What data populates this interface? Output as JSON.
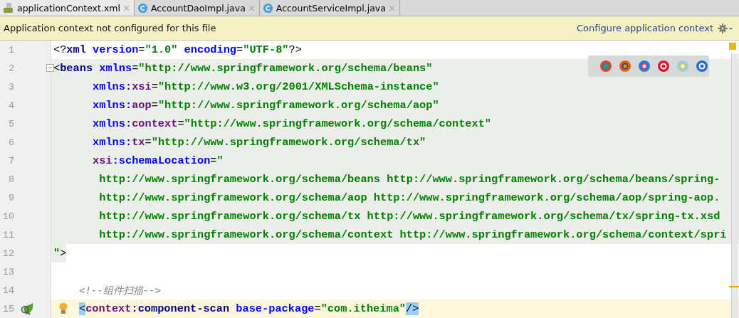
{
  "tabs": [
    {
      "label": "applicationContext.xml",
      "kind": "xml",
      "selected": true
    },
    {
      "label": "AccountDaoImpl.java",
      "kind": "class",
      "selected": false
    },
    {
      "label": "AccountServiceImpl.java",
      "kind": "class",
      "selected": false
    }
  ],
  "banner": {
    "message": "Application context not configured for this file",
    "link": "Configure application context"
  },
  "editor": {
    "lines": [
      {
        "number": "1",
        "kind": "plain",
        "nested": false,
        "fold": false,
        "current": false,
        "tokens": [
          {
            "kind": "punct",
            "text": "<?"
          },
          {
            "kind": "tag",
            "text": "xml"
          },
          {
            "kind": "attr",
            "text": " version"
          },
          {
            "kind": "punct",
            "text": "="
          },
          {
            "kind": "value",
            "text": "\"1.0\""
          },
          {
            "kind": "attr",
            "text": " encoding"
          },
          {
            "kind": "punct",
            "text": "="
          },
          {
            "kind": "value",
            "text": "\"UTF-8\""
          },
          {
            "kind": "punct",
            "text": "?>"
          }
        ]
      },
      {
        "number": "2",
        "kind": "scope",
        "nested": false,
        "fold": true,
        "current": false,
        "tokens": [
          {
            "kind": "punct",
            "text": "<"
          },
          {
            "kind": "tag",
            "text": "beans"
          },
          {
            "kind": "attr",
            "text": " xmlns"
          },
          {
            "kind": "punct",
            "text": "="
          },
          {
            "kind": "value",
            "text": "\"http://www.springframework.org/schema/beans\""
          }
        ]
      },
      {
        "number": "3",
        "kind": "scope",
        "nested": false,
        "fold": false,
        "current": false,
        "tokens": [
          {
            "kind": "attr",
            "text": "      xmlns:"
          },
          {
            "kind": "ns",
            "text": "xsi"
          },
          {
            "kind": "punct",
            "text": "="
          },
          {
            "kind": "value",
            "text": "\"http://www.w3.org/2001/XMLSchema-instance\""
          }
        ]
      },
      {
        "number": "4",
        "kind": "scope",
        "nested": false,
        "fold": false,
        "current": false,
        "tokens": [
          {
            "kind": "attr",
            "text": "      xmlns:"
          },
          {
            "kind": "ns",
            "text": "aop"
          },
          {
            "kind": "punct",
            "text": "="
          },
          {
            "kind": "value",
            "text": "\"http://www.springframework.org/schema/aop\""
          }
        ]
      },
      {
        "number": "5",
        "kind": "scope",
        "nested": false,
        "fold": false,
        "current": false,
        "tokens": [
          {
            "kind": "attr",
            "text": "      xmlns:"
          },
          {
            "kind": "ns",
            "text": "context"
          },
          {
            "kind": "punct",
            "text": "="
          },
          {
            "kind": "value",
            "text": "\"http://www.springframework.org/schema/context\""
          }
        ]
      },
      {
        "number": "6",
        "kind": "scope",
        "nested": false,
        "fold": false,
        "current": false,
        "tokens": [
          {
            "kind": "attr",
            "text": "      xmlns:"
          },
          {
            "kind": "ns",
            "text": "tx"
          },
          {
            "kind": "punct",
            "text": "="
          },
          {
            "kind": "value",
            "text": "\"http://www.springframework.org/schema/tx\""
          }
        ]
      },
      {
        "number": "7",
        "kind": "scope",
        "nested": false,
        "fold": false,
        "current": false,
        "tokens": [
          {
            "kind": "ns",
            "text": "      xsi"
          },
          {
            "kind": "attr",
            "text": ":schemaLocation"
          },
          {
            "kind": "punct",
            "text": "="
          },
          {
            "kind": "value",
            "text": "\""
          }
        ]
      },
      {
        "number": "8",
        "kind": "scope",
        "nested": false,
        "fold": false,
        "current": false,
        "tokens": [
          {
            "kind": "value",
            "text": "       http://www.springframework.org/schema/beans http://www.springframework.org/schema/beans/spring-"
          }
        ]
      },
      {
        "number": "9",
        "kind": "scope",
        "nested": false,
        "fold": false,
        "current": false,
        "tokens": [
          {
            "kind": "value",
            "text": "       http://www.springframework.org/schema/aop http://www.springframework.org/schema/aop/spring-aop."
          }
        ]
      },
      {
        "number": "10",
        "kind": "scope",
        "nested": false,
        "fold": false,
        "current": false,
        "tokens": [
          {
            "kind": "value",
            "text": "       http://www.springframework.org/schema/tx http://www.springframework.org/schema/tx/spring-tx.xsd"
          }
        ]
      },
      {
        "number": "11",
        "kind": "scope",
        "nested": false,
        "fold": false,
        "current": false,
        "tokens": [
          {
            "kind": "value",
            "text": "       http://www.springframework.org/schema/context http://www.springframework.org/schema/context/spri"
          }
        ]
      },
      {
        "number": "12",
        "kind": "scope-end",
        "nested": false,
        "fold": false,
        "current": false,
        "tokens": [
          {
            "kind": "value",
            "text": "\""
          },
          {
            "kind": "punct",
            "text": ">"
          }
        ]
      },
      {
        "number": "13",
        "kind": "plain",
        "fold": false,
        "current": false
      },
      {
        "number": "14",
        "kind": "plain",
        "nested": true,
        "fold": false,
        "current": false,
        "tokens": [
          {
            "kind": "comment",
            "text": "<!--组件扫描-->"
          }
        ]
      },
      {
        "number": "15",
        "kind": "plain",
        "nested": true,
        "fold": false,
        "current": true,
        "tokens": [
          {
            "kind": "matched",
            "text": "<"
          },
          {
            "kind": "ns",
            "text": "context"
          },
          {
            "kind": "tag",
            "text": ":component-scan"
          },
          {
            "kind": "attr",
            "text": " base-package"
          },
          {
            "kind": "punct",
            "text": "="
          },
          {
            "kind": "value",
            "text": "\"com.itheima\""
          },
          {
            "kind": "matched",
            "text": "/>"
          }
        ]
      }
    ]
  }
}
